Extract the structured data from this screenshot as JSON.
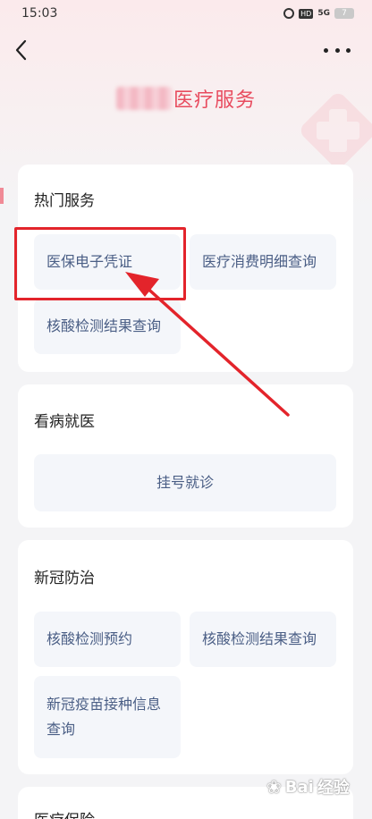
{
  "status_bar": {
    "time": "15:03",
    "hd": "HD",
    "signal": "5G",
    "battery": "7"
  },
  "page": {
    "title": "医疗服务"
  },
  "sections": {
    "hot": {
      "title": "热门服务",
      "items": [
        "医保电子凭证",
        "医疗消费明细查询",
        "核酸检测结果查询"
      ]
    },
    "clinic": {
      "title": "看病就医",
      "items": [
        "挂号就诊"
      ]
    },
    "covid": {
      "title": "新冠防治",
      "items": [
        "核酸检测预约",
        "核酸检测结果查询",
        "新冠疫苗接种信息查询"
      ]
    },
    "insurance": {
      "title": "医疗保险"
    }
  },
  "annotation": {
    "color": "#e3242b"
  },
  "watermark": {
    "brand": "Bai",
    "brand_suffix": "经验",
    "sub": "jingyan.baidu.com"
  },
  "colors": {
    "accent_red": "#e84b5e",
    "tile_text": "#4a5e85",
    "tile_bg": "#f4f6fa"
  },
  "icons": [
    "back-icon",
    "more-icon",
    "alarm-icon",
    "medical-cross-icon"
  ]
}
